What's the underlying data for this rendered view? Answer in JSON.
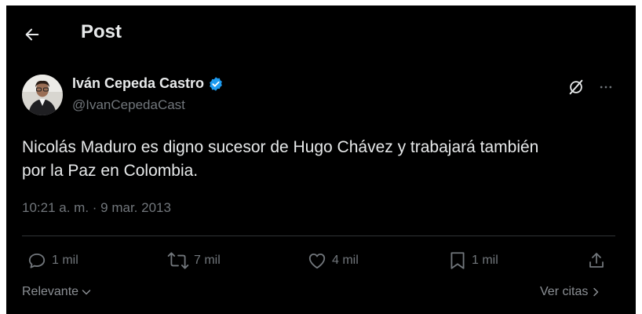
{
  "header": {
    "title": "Post"
  },
  "author": {
    "name": "Iván Cepeda Castro",
    "handle": "@IvanCepedaCast"
  },
  "post": {
    "text_line1": "Nicolás Maduro es digno sucesor de Hugo Chávez y trabajará también",
    "text_line2": "por la Paz en Colombia.",
    "timestamp": "10:21 a. m. · 9 mar. 2013"
  },
  "actions": {
    "replies": "1 mil",
    "reposts": "7 mil",
    "likes": "4 mil",
    "bookmarks": "1 mil"
  },
  "footer": {
    "sort_label": "Relevante",
    "quotes_label": "Ver citas"
  },
  "colors": {
    "background": "#000000",
    "text_primary": "#e7e9ea",
    "text_secondary": "#71767b",
    "verified_badge": "#1d9bf0",
    "divider": "#2f3336"
  },
  "icons": {
    "back": "arrow-left-icon",
    "verified": "verified-badge-icon",
    "grok": "grok-icon",
    "more": "more-horizontal-icon",
    "reply": "reply-icon",
    "repost": "repost-icon",
    "like": "heart-icon",
    "bookmark": "bookmark-icon",
    "share": "share-icon"
  }
}
